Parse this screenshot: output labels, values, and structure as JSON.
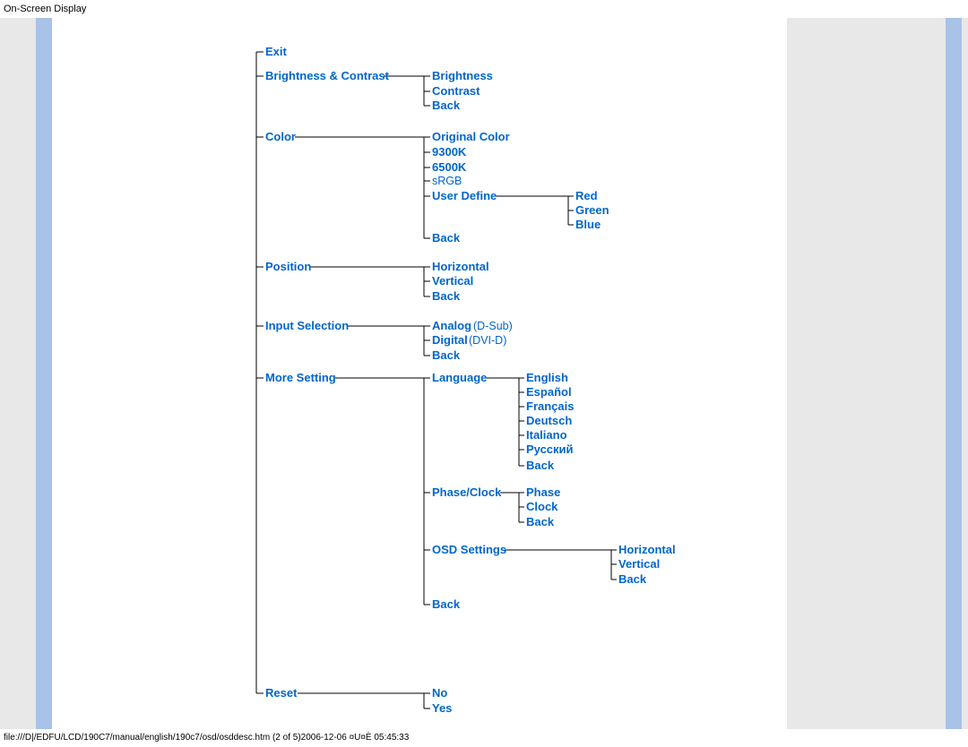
{
  "title": "On-Screen Display",
  "footer": "file:///D|/EDFU/LCD/190C7/manual/english/190c7/osd/osddesc.htm (2 of 5)2006-12-06 ¤U¤È 05:45:33",
  "menu": {
    "exit": "Exit",
    "brightness_contrast": "Brightness &  Contrast",
    "bc_brightness": "Brightness",
    "bc_contrast": "Contrast",
    "bc_back": "Back",
    "color": "Color",
    "co_original": "Original Color",
    "co_9300k": "9300K",
    "co_6500k": "6500K",
    "co_srgb": "sRGB",
    "co_userdef": "User Define",
    "co_ud_red": "Red",
    "co_ud_green": "Green",
    "co_ud_blue": "Blue",
    "co_back": "Back",
    "position": "Position",
    "po_horizontal": "Horizontal",
    "po_vertical": "Vertical",
    "po_back": "Back",
    "input_sel": "Input Selection",
    "is_analog": "Analog",
    "is_analog_sub": "(D-Sub)",
    "is_digital": "Digital",
    "is_digital_sub": "(DVI-D)",
    "is_back": "Back",
    "more_setting": "More Setting",
    "ms_language": "Language",
    "ms_lang_en": "English",
    "ms_lang_es": "Español",
    "ms_lang_fr": "Français",
    "ms_lang_de": "Deutsch",
    "ms_lang_it": "Italiano",
    "ms_lang_ru": "Русский",
    "ms_lang_back": "Back",
    "ms_phaseclock": "Phase/Clock",
    "ms_pc_phase": "Phase",
    "ms_pc_clock": "Clock",
    "ms_pc_back": "Back",
    "ms_osd": "OSD Settings",
    "ms_osd_horizontal": "Horizontal",
    "ms_osd_vertical": "Vertical",
    "ms_osd_back": "Back",
    "ms_back": "Back",
    "reset": "Reset",
    "re_no": "No",
    "re_yes": "Yes"
  }
}
